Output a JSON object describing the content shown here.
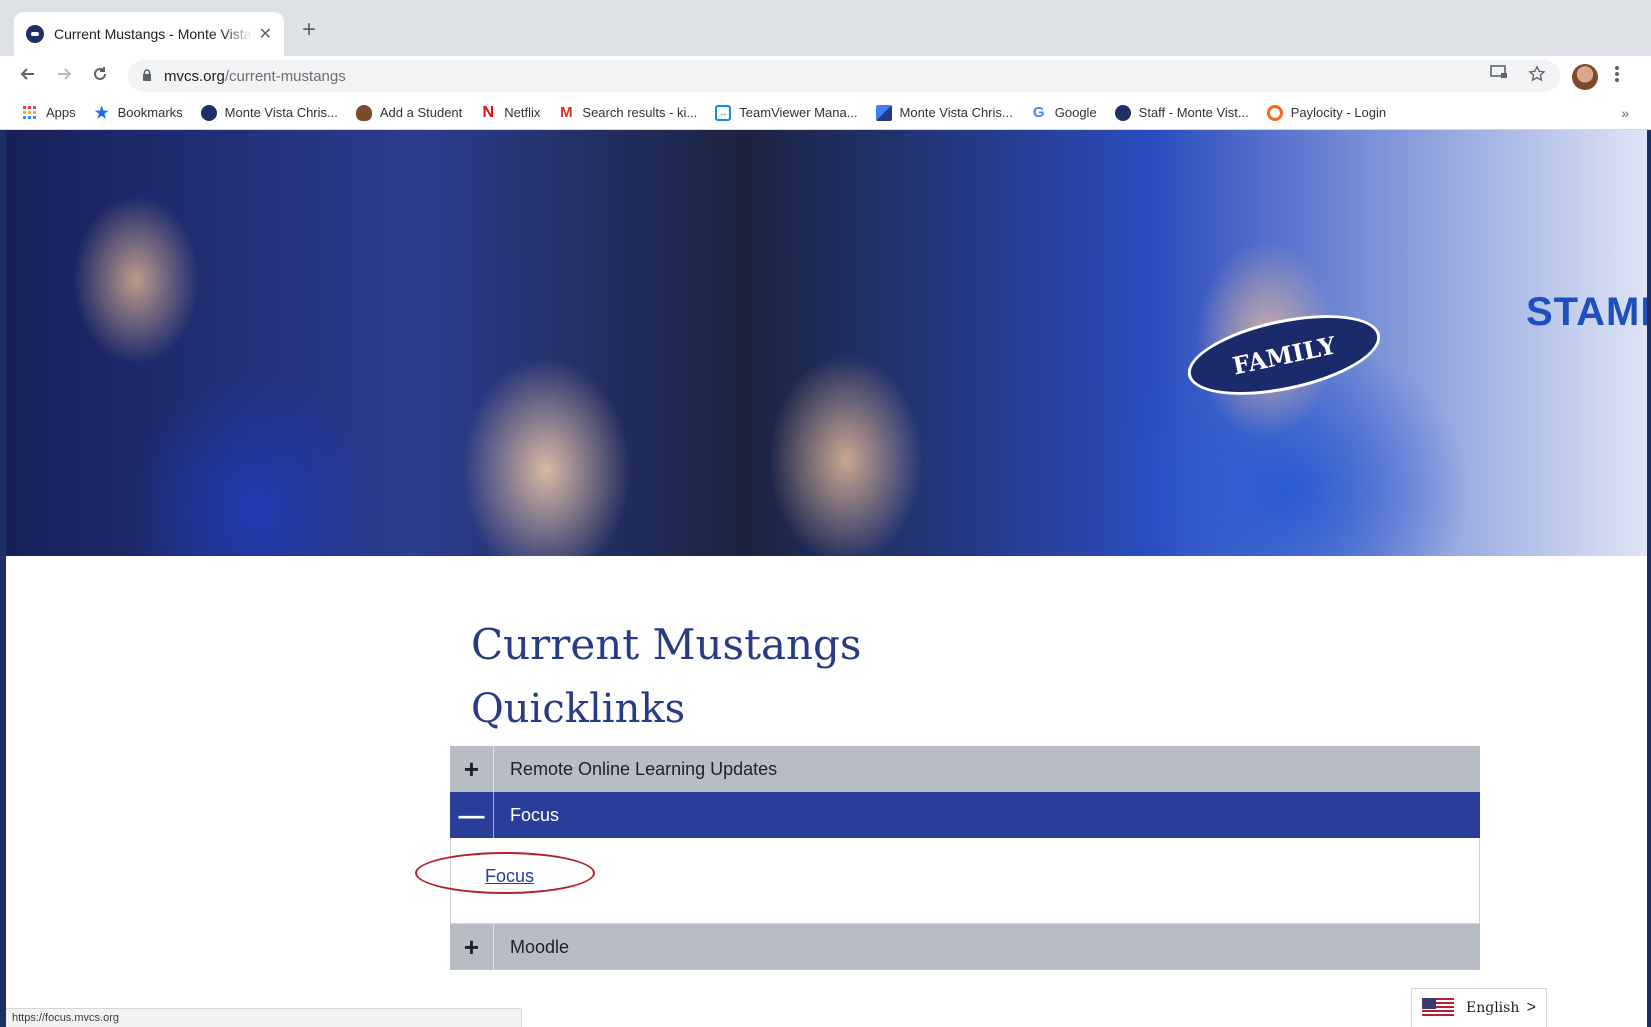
{
  "browser": {
    "tab": {
      "title": "Current Mustangs - Monte Vista",
      "close_glyph": "✕"
    },
    "new_tab_glyph": "+",
    "address": {
      "host": "mvcs.org",
      "path": "/current-mustangs"
    },
    "bookmarks": [
      {
        "label": "Apps",
        "icon": "apps-grid-icon"
      },
      {
        "label": "Bookmarks",
        "icon": "star-icon"
      },
      {
        "label": "Monte Vista Chris...",
        "icon": "mvcs-icon"
      },
      {
        "label": "Add a Student",
        "icon": "student-icon"
      },
      {
        "label": "Netflix",
        "icon": "netflix-icon"
      },
      {
        "label": "Search results - ki...",
        "icon": "gmail-icon"
      },
      {
        "label": "TeamViewer Mana...",
        "icon": "teamviewer-icon"
      },
      {
        "label": "Monte Vista Chris...",
        "icon": "puzzle-icon"
      },
      {
        "label": "Google",
        "icon": "google-icon"
      },
      {
        "label": "Staff - Monte Vist...",
        "icon": "mvcs-icon"
      },
      {
        "label": "Paylocity - Login",
        "icon": "paylocity-icon"
      }
    ],
    "status_url": "https://focus.mvcs.org"
  },
  "hero": {
    "shirt_text": "FAMILY",
    "stamp_text": "STAMP"
  },
  "page": {
    "title": "Current Mustangs",
    "section_title": "Quicklinks"
  },
  "accordion": [
    {
      "sign": "+",
      "label": "Remote Online Learning Updates",
      "expanded": false
    },
    {
      "sign": "—",
      "label": "Focus",
      "expanded": true,
      "link": "Focus"
    },
    {
      "sign": "+",
      "label": "Moodle",
      "expanded": false
    }
  ],
  "language": {
    "label": "English",
    "chevron": ">"
  },
  "colors": {
    "brand_blue": "#2a3d98",
    "heading_blue": "#2a3b86",
    "accordion_gray": "#b8bcc4",
    "annotation_red": "#b0222b"
  }
}
